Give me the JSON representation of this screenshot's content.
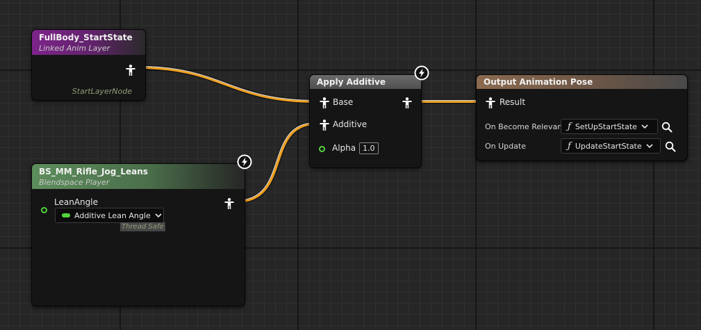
{
  "colors": {
    "background": "#262626",
    "pose_wire": "#f0a020",
    "float_pin": "#52d43c",
    "linked_layer_header": "#7d248a",
    "blendspace_header": "#5d8e5d",
    "apply_additive_header": "#6b6b6b",
    "output_pose_header": "#8b6a4f"
  },
  "icons": {
    "pose_pin": "person-pose-icon",
    "fast_path": "lightning-bolt-icon",
    "function": "function-f-icon",
    "browse": "magnifier-icon",
    "dropdown": "chevron-down-icon",
    "float_pin": "circle-pin-icon"
  },
  "nodes": {
    "fullbody": {
      "title": "FullBody_StartState",
      "subtitle": "Linked Anim Layer",
      "footer": "StartLayerNode"
    },
    "blendspace": {
      "title": "BS_MM_Rifle_Jog_Leans",
      "subtitle": "Blendspace Player",
      "pin_label": "LeanAngle",
      "variable": "Additive Lean Angle",
      "badge": "Thread Safe"
    },
    "apply_additive": {
      "title": "Apply Additive",
      "pins": {
        "base": "Base",
        "additive": "Additive",
        "alpha": "Alpha"
      },
      "alpha_value": "1.0"
    },
    "output_pose": {
      "title": "Output Animation Pose",
      "result": "Result",
      "on_become_relevant": {
        "label": "On Become Relevant",
        "function": "SetUpStartState"
      },
      "on_update": {
        "label": "On Update",
        "function": "UpdateStartState"
      }
    }
  }
}
